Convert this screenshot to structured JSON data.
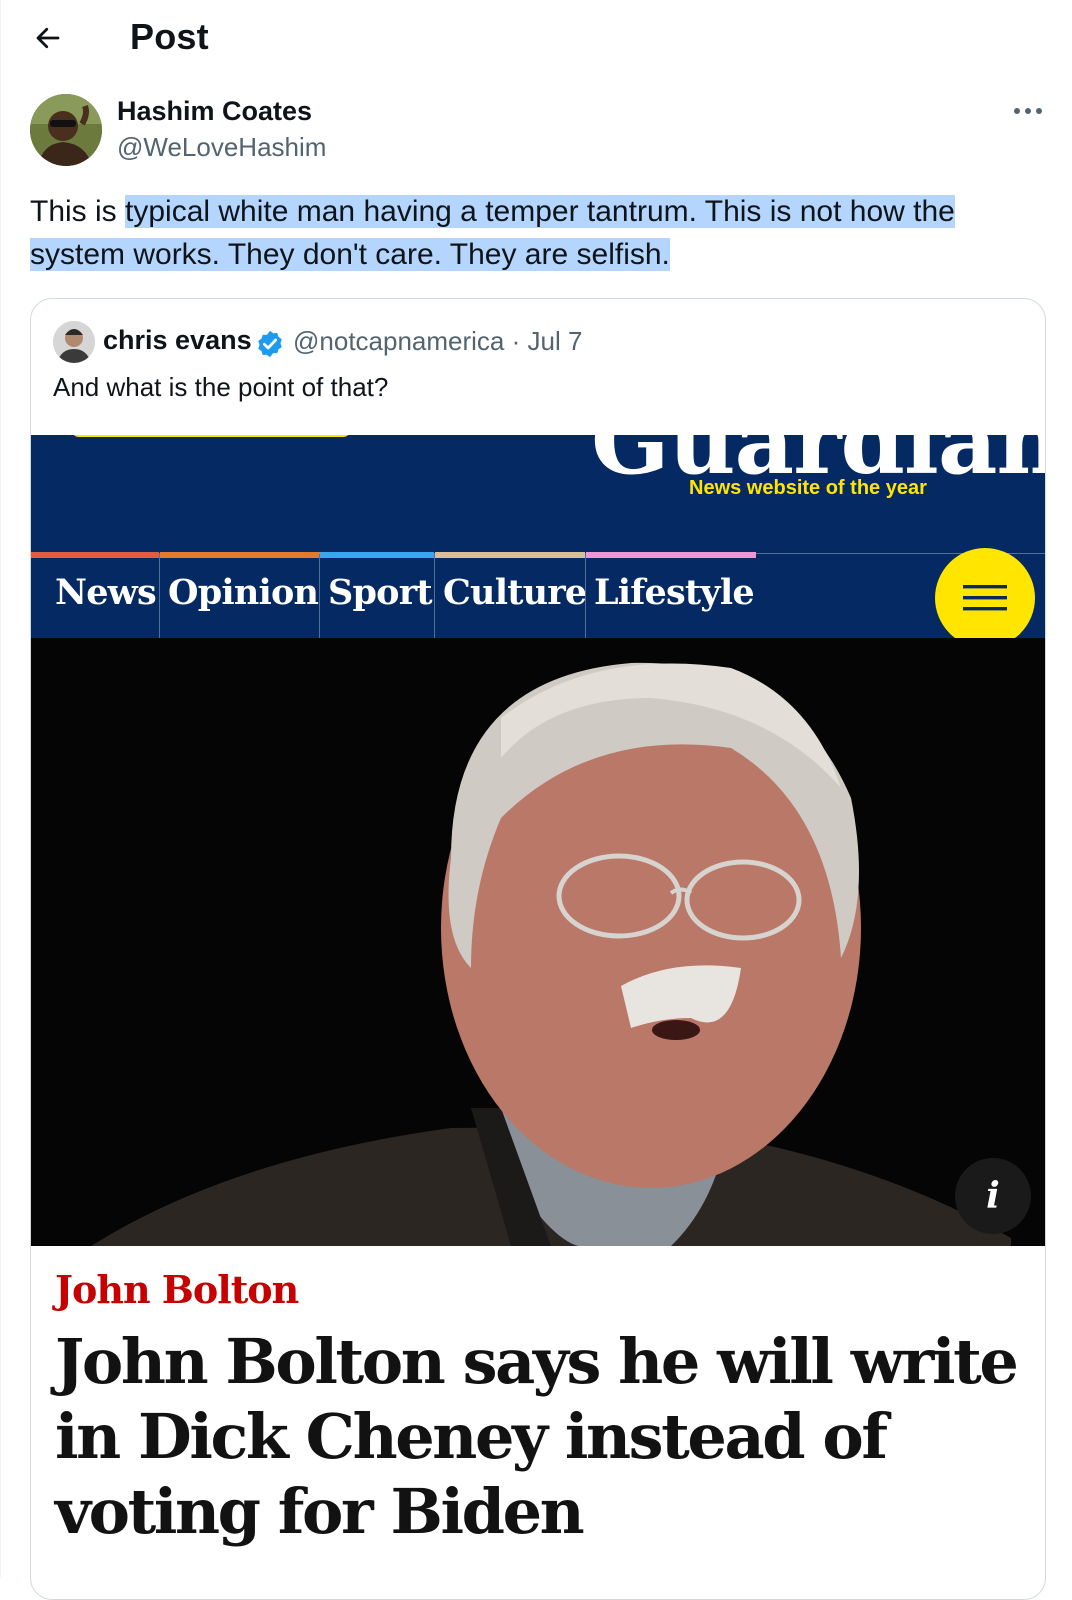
{
  "header": {
    "title": "Post",
    "back_icon": "arrow-left-icon"
  },
  "tweet": {
    "author_name": "Hashim Coates",
    "author_handle": "@WeLoveHashim",
    "text_plain": "This is ",
    "text_selected": "typical white man having a temper tantrum. This is not how the system works. They don't care. They are selfish.",
    "selection_color": "#b4d5fe"
  },
  "quote": {
    "author_name": "chris evans",
    "verified": true,
    "meta": "@notcapnamerica · Jul 7",
    "text": "And what is the point of that?"
  },
  "guardian": {
    "logo_text": "Guardian",
    "tagline": "News website of the year",
    "nav": [
      {
        "label": "News",
        "color": "#e05e3c"
      },
      {
        "label": "Opinion",
        "color": "#e37b2e"
      },
      {
        "label": "Sport",
        "color": "#3ca5f0"
      },
      {
        "label": "Culture",
        "color": "#d8c094"
      },
      {
        "label": "Lifestyle",
        "color": "#f195d6"
      }
    ],
    "menu_icon": "hamburger-menu-icon",
    "info_label": "i",
    "kicker": "John Bolton",
    "headline": "John Bolton says he will write in Dick Cheney instead of voting for Biden",
    "colors": {
      "brand_blue": "#052962",
      "accent_yellow": "#ffe500",
      "kicker_red": "#c70000"
    }
  }
}
